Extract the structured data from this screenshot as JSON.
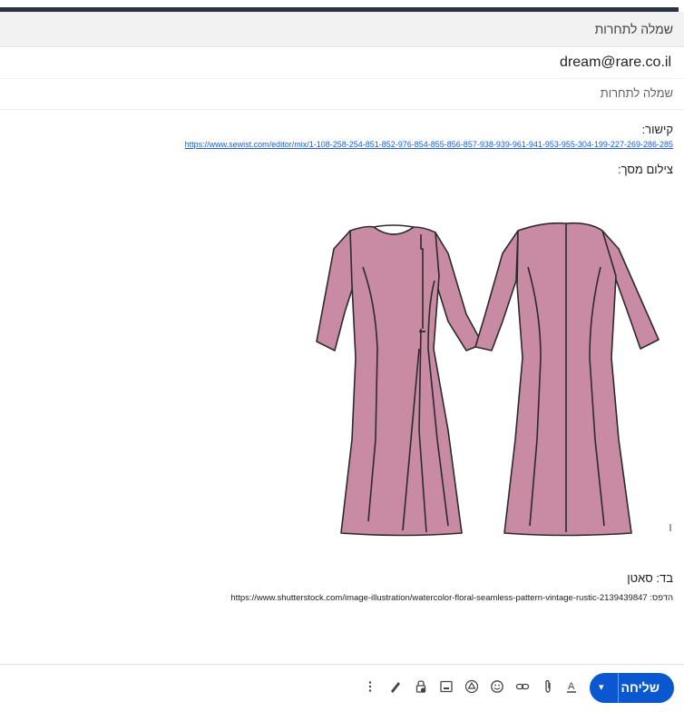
{
  "window": {
    "title": "שמלה לתחרות"
  },
  "compose": {
    "to": "dream@rare.co.il",
    "subject": "שמלה לתחרות"
  },
  "body": {
    "link_label": "קישור:",
    "link_url": "https://www.sewist.com/editor/mix/1-108-258-254-851-852-976-854-855-856-857-938-939-961-941-953-955-304-199-227-269-286-285",
    "screenshot_label": "צילום מסך:",
    "fabric_line": "בד: סאטן",
    "print_label": "הדפס:",
    "print_url": "https://www.shutterstock.com/image-illustration/watercolor-floral-seamless-pattern-vintage-rustic-2139439847"
  },
  "illustration": {
    "dress_color": "#c98aa3",
    "outline_color": "#2b2b2b"
  },
  "toolbar": {
    "send_label": "שליחה",
    "icons": [
      "more-options-icon",
      "signature-icon",
      "confidential-mode-icon",
      "insert-photo-icon",
      "drive-icon",
      "emoji-icon",
      "insert-link-icon",
      "attach-icon",
      "formatting-icon"
    ]
  },
  "colors": {
    "send_button": "#0b57d0",
    "link": "#1a5dd6",
    "header_bg": "#f2f2f2"
  }
}
